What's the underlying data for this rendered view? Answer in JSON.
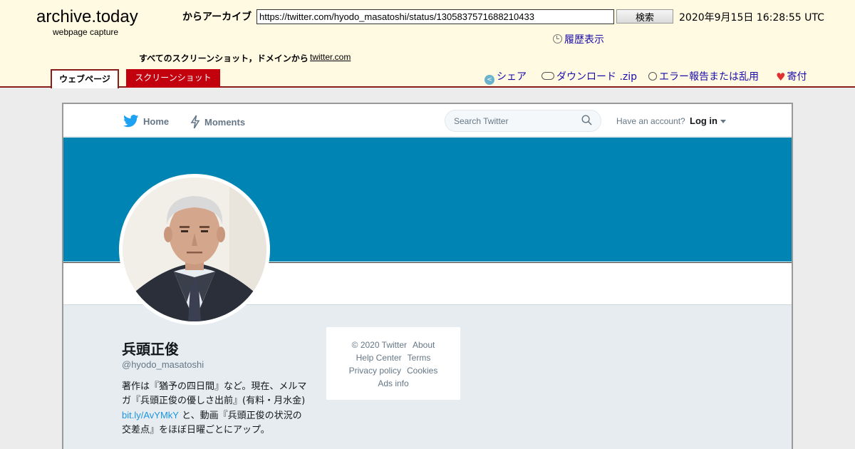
{
  "archive": {
    "brand_title": "archive.today",
    "brand_subtitle": "webpage capture",
    "archive_label": "からアーカイブ",
    "url_value": "https://twitter.com/hyodo_masatoshi/status/1305837571688210433",
    "search_button": "検索",
    "capture_date": "2020年9月15日 16:28:55 UTC",
    "history_link": "履歴表示",
    "domain_line": "すべてのスクリーンショット，ドメインから",
    "domain_link": "twitter.com",
    "tabs": [
      {
        "label": "ウェブページ",
        "active": true
      },
      {
        "label": "スクリーンショット",
        "active": false
      }
    ],
    "actions": {
      "share": "シェア",
      "download": "ダウンロード .zip",
      "report": "エラー報告または乱用",
      "donate": "寄付"
    },
    "colors": {
      "header_bg": "#fffae1",
      "accent": "#8b1c1c",
      "tab_inactive": "#c3000e",
      "link": "#1a0dab"
    }
  },
  "twitter": {
    "nav": {
      "home": "Home",
      "moments": "Moments",
      "search_placeholder": "Search Twitter",
      "account_prompt": "Have an account?",
      "login": "Log in"
    },
    "colors": {
      "banner": "#0084b4",
      "brand_blue": "#1da1f2",
      "muted": "#657786"
    },
    "profile": {
      "name": "兵頭正俊",
      "handle": "@hyodo_masatoshi",
      "bio_before": "著作は『猶予の四日間』など。現在、メルマガ『兵頭正俊の優しさ出前』(有料・月水金) ",
      "bio_link": "bit.ly/AvYMkY",
      "bio_after": " と、動画『兵頭正俊の状況の交差点』をほぼ日曜ごとにアップ。"
    },
    "footer": {
      "copyright": "© 2020 Twitter",
      "about": "About",
      "help": "Help Center",
      "terms": "Terms",
      "privacy": "Privacy policy",
      "cookies": "Cookies",
      "ads": "Ads info"
    }
  }
}
